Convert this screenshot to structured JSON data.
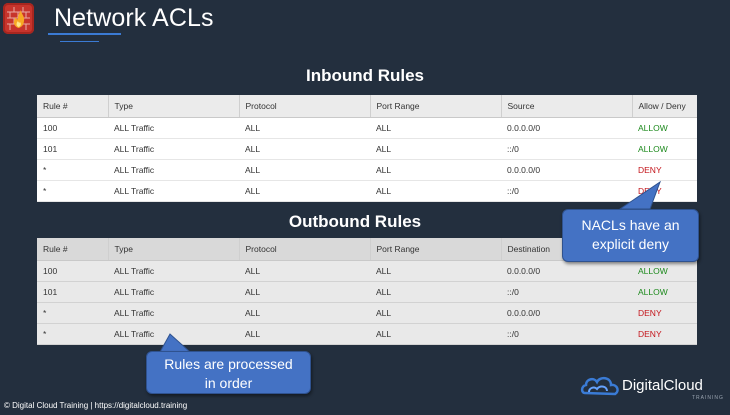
{
  "header": {
    "title": "Network ACLs",
    "logo_icon": "firewall-icon"
  },
  "inbound": {
    "heading": "Inbound Rules",
    "columns": [
      "Rule #",
      "Type",
      "Protocol",
      "Port Range",
      "Source",
      "Allow / Deny"
    ],
    "rows": [
      [
        "100",
        "ALL Traffic",
        "ALL",
        "ALL",
        "0.0.0.0/0",
        "ALLOW"
      ],
      [
        "101",
        "ALL Traffic",
        "ALL",
        "ALL",
        "::/0",
        "ALLOW"
      ],
      [
        "*",
        "ALL Traffic",
        "ALL",
        "ALL",
        "0.0.0.0/0",
        "DENY"
      ],
      [
        "*",
        "ALL Traffic",
        "ALL",
        "ALL",
        "::/0",
        "DENY"
      ]
    ]
  },
  "outbound": {
    "heading": "Outbound Rules",
    "columns": [
      "Rule #",
      "Type",
      "Protocol",
      "Port Range",
      "Destination",
      ""
    ],
    "rows": [
      [
        "100",
        "ALL Traffic",
        "ALL",
        "ALL",
        "0.0.0.0/0",
        "ALLOW"
      ],
      [
        "101",
        "ALL Traffic",
        "ALL",
        "ALL",
        "::/0",
        "ALLOW"
      ],
      [
        "*",
        "ALL Traffic",
        "ALL",
        "ALL",
        "0.0.0.0/0",
        "DENY"
      ],
      [
        "*",
        "ALL Traffic",
        "ALL",
        "ALL",
        "::/0",
        "DENY"
      ]
    ]
  },
  "callouts": {
    "deny_line1": "NACLs have an",
    "deny_line2": "explicit deny",
    "order_line1": "Rules are processed",
    "order_line2": "in order"
  },
  "footer": {
    "text": "© Digital Cloud Training  |  https://digitalcloud.training"
  },
  "brand": {
    "name": "DigitalCloud",
    "sub": "TRAINING",
    "icon": "cloud-logo-icon"
  },
  "colors": {
    "background": "#232f3e",
    "allow": "#1d8a1d",
    "deny": "#c4161c",
    "callout": "#4472c4"
  }
}
